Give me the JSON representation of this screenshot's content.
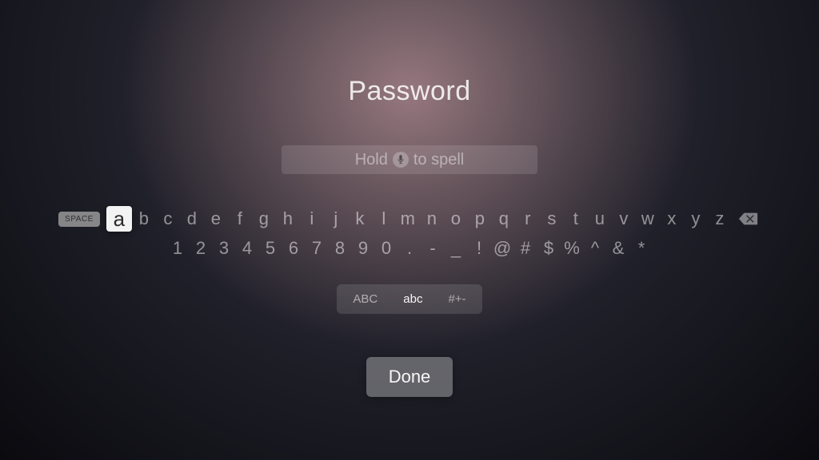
{
  "title": "Password",
  "input": {
    "hint_prefix": "Hold",
    "hint_suffix": "to spell"
  },
  "keyboard": {
    "space_label": "SPACE",
    "row1": [
      "a",
      "b",
      "c",
      "d",
      "e",
      "f",
      "g",
      "h",
      "i",
      "j",
      "k",
      "l",
      "m",
      "n",
      "o",
      "p",
      "q",
      "r",
      "s",
      "t",
      "u",
      "v",
      "w",
      "x",
      "y",
      "z"
    ],
    "selected_key": "a",
    "row2": [
      "1",
      "2",
      "3",
      "4",
      "5",
      "6",
      "7",
      "8",
      "9",
      "0",
      ".",
      "-",
      "_",
      "!",
      "@",
      "#",
      "$",
      "%",
      "^",
      "&",
      "*"
    ]
  },
  "modes": {
    "uppercase": "ABC",
    "lowercase": "abc",
    "symbols": "#+-",
    "active": "lowercase"
  },
  "done_label": "Done"
}
